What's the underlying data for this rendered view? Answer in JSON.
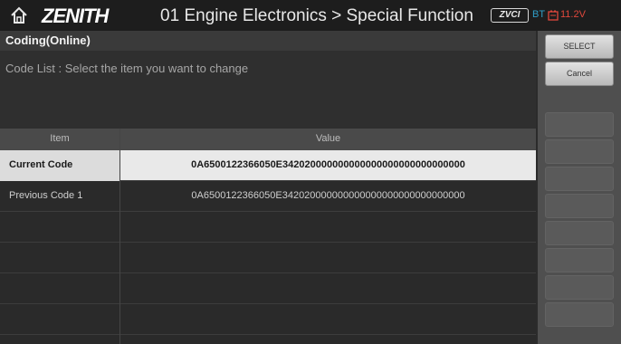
{
  "header": {
    "brand": "ZENITH",
    "title": "01 Engine Electronics > Special Function",
    "vci": "ZVCI",
    "bt": "BT",
    "voltage": "11.2V"
  },
  "subheader": {
    "title": "Coding(Online)"
  },
  "instruction": "Code List : Select the item you want to change",
  "table": {
    "columns": [
      "Item",
      "Value"
    ],
    "rows": [
      {
        "item": "Current Code",
        "value": "0A6500122366050E342020000000000000000000000000000"
      },
      {
        "item": "Previous Code 1",
        "value": "0A6500122366050E342020000000000000000000000000000"
      }
    ],
    "selected_row": 0
  },
  "side_panel": {
    "select_label": "SELECT",
    "cancel_label": "Cancel"
  },
  "colors": {
    "header_bg": "#1d1d1d",
    "bt": "#2f9ec8",
    "voltage": "#e0483c",
    "selected_row": "#e9e9e9"
  }
}
